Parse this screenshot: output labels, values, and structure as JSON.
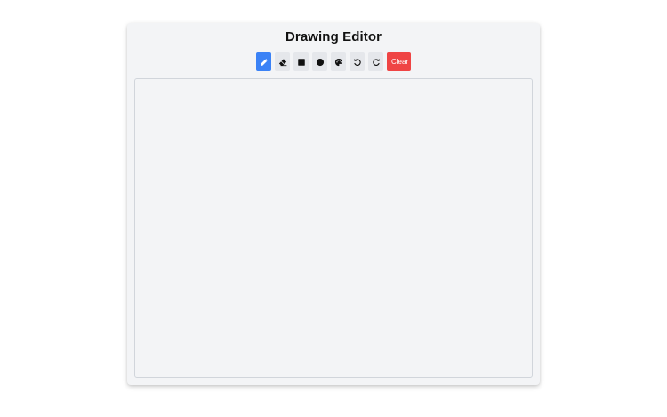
{
  "app": {
    "title": "Drawing Editor"
  },
  "toolbar": {
    "tools": [
      {
        "name": "pencil-tool",
        "icon": "pencil-icon",
        "active": true
      },
      {
        "name": "eraser-tool",
        "icon": "eraser-icon",
        "active": false
      },
      {
        "name": "rectangle-tool",
        "icon": "square-icon",
        "active": false
      },
      {
        "name": "circle-tool",
        "icon": "circle-icon",
        "active": false
      },
      {
        "name": "color-tool",
        "icon": "palette-icon",
        "active": false
      },
      {
        "name": "undo-tool",
        "icon": "undo-icon",
        "active": false
      },
      {
        "name": "redo-tool",
        "icon": "redo-icon",
        "active": false
      }
    ],
    "clear_label": "Clear"
  },
  "colors": {
    "active_tool": "#3b82f6",
    "clear_button": "#ef4444",
    "panel_background": "#f3f4f6",
    "tool_background": "#e5e7eb"
  }
}
